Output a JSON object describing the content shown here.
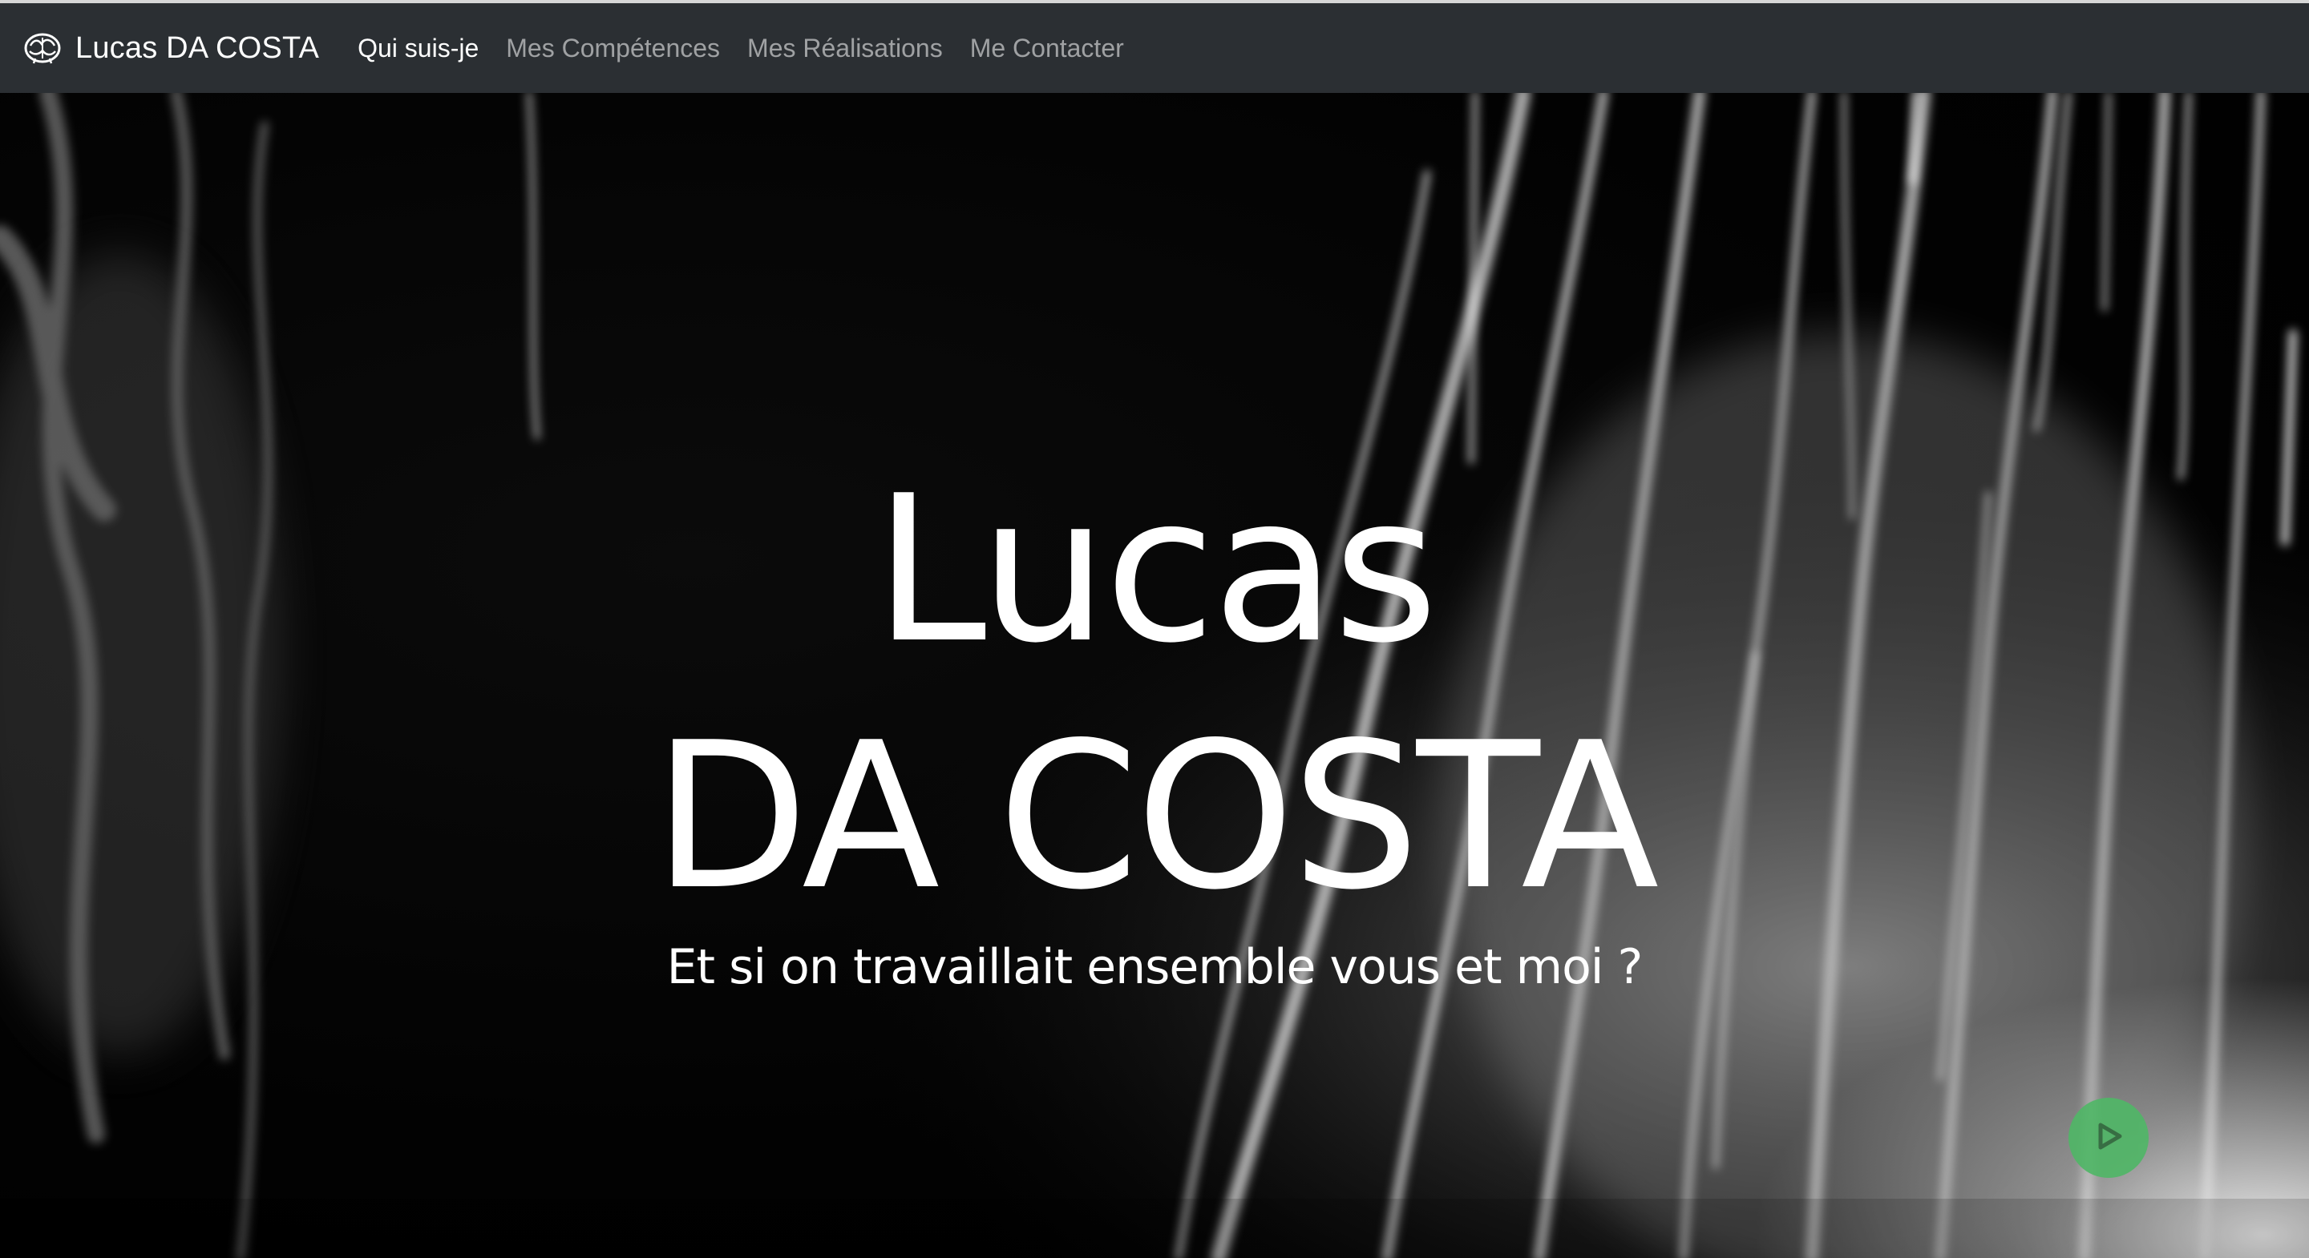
{
  "navbar": {
    "brand_text": "Lucas DA COSTA",
    "brand_logo_icon": "brain-icon",
    "items": [
      {
        "label": "Qui suis-je",
        "active": true
      },
      {
        "label": "Mes Compétences",
        "active": false
      },
      {
        "label": "Mes Réalisations",
        "active": false
      },
      {
        "label": "Me Contacter",
        "active": false
      }
    ]
  },
  "hero": {
    "first_name": "Lucas",
    "last_name": "DA COSTA",
    "subtitle": "Et si on travaillait ensemble vous et moi ?",
    "background": "smoke-light-streaks-image",
    "play_button_icon": "play-icon"
  },
  "colors": {
    "navbar_bg": "#2b2f33",
    "nav_active": "#ffffff",
    "nav_inactive": "#9a9da0",
    "play_button": "#4fb766",
    "text": "#ffffff"
  }
}
